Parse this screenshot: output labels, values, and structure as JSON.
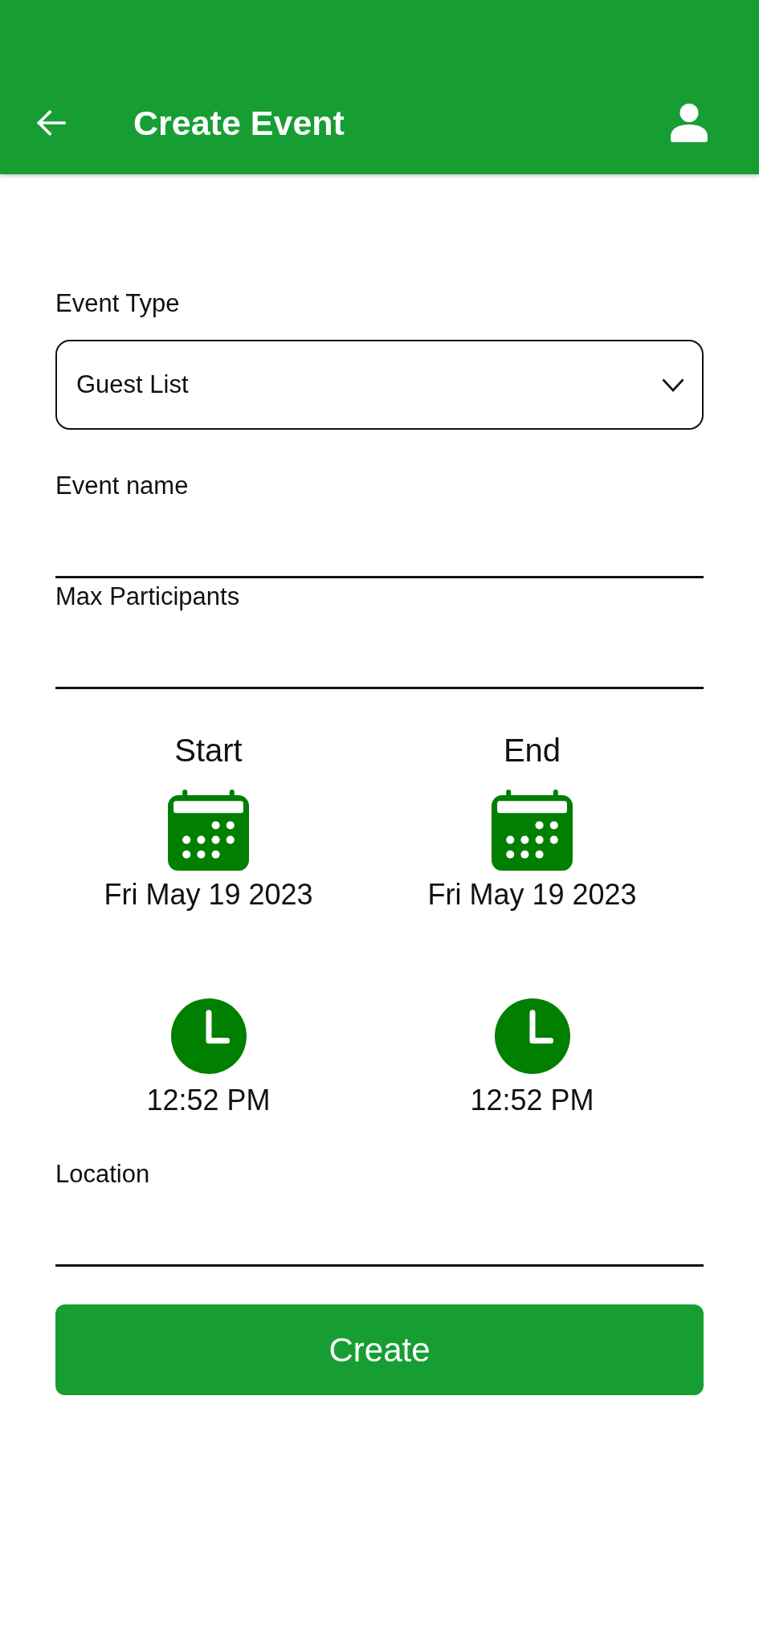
{
  "app_bar": {
    "title": "Create Event"
  },
  "event_type": {
    "label": "Event Type",
    "value": "Guest List"
  },
  "text_fields": [
    {
      "label": "Event name"
    },
    {
      "label": "Max Participants"
    }
  ],
  "schedule": [
    {
      "heading": "Start",
      "date": "Fri May 19 2023",
      "time": "12:52 PM"
    },
    {
      "heading": "End",
      "date": "Fri May 19 2023",
      "time": "12:52 PM"
    }
  ],
  "location": {
    "label": "Location"
  },
  "create_button": {
    "label": "Create"
  }
}
